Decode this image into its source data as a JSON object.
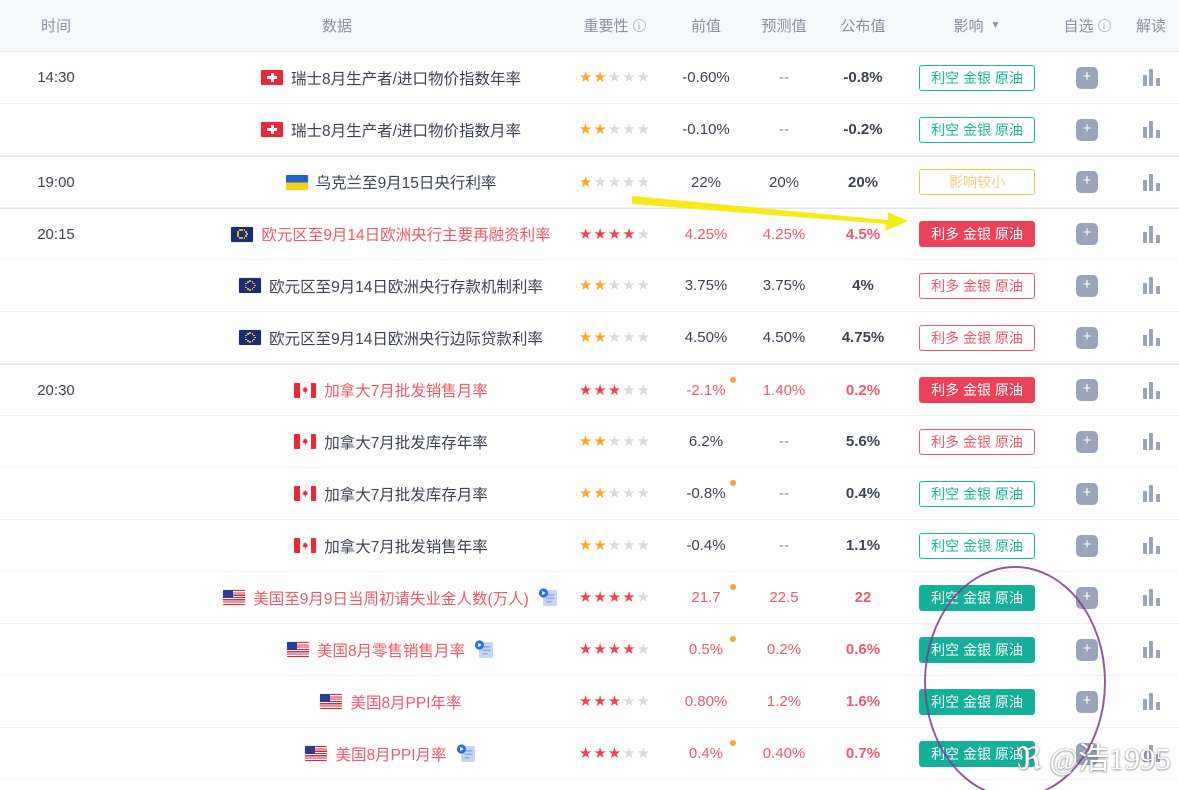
{
  "header": {
    "columns": [
      {
        "key": "time",
        "label": "时间",
        "icon": null,
        "sort": false
      },
      {
        "key": "data",
        "label": "数据",
        "icon": null,
        "sort": false
      },
      {
        "key": "importance",
        "label": "重要性",
        "icon": "info-icon",
        "sort": false
      },
      {
        "key": "previous",
        "label": "前值",
        "icon": null,
        "sort": false
      },
      {
        "key": "forecast",
        "label": "预测值",
        "icon": null,
        "sort": false
      },
      {
        "key": "actual",
        "label": "公布值",
        "icon": null,
        "sort": false
      },
      {
        "key": "effect",
        "label": "影响",
        "icon": null,
        "sort": true
      },
      {
        "key": "favorite",
        "label": "自选",
        "icon": "info-icon",
        "sort": false
      },
      {
        "key": "read",
        "label": "解读",
        "icon": null,
        "sort": false
      }
    ],
    "sort_caret": "▼"
  },
  "colors": {
    "accent_red": "#f2576b",
    "solid_red": "#ec4259",
    "teal": "#16b8a0",
    "solid_teal": "#14b09a",
    "amber": "#f5c24b",
    "star_gold": "#f7a828",
    "star_red": "#ef4357",
    "header_bg": "#f7f8fa",
    "annotation_yellow": "#f6ea16",
    "annotation_purple": "#7b3f8f"
  },
  "rows": [
    {
      "time": "14:30",
      "group_start": false,
      "flag": "switzerland",
      "name": "瑞士8月生产者/进口物价指数年率",
      "highlight": false,
      "has_article_icon": false,
      "stars": 2,
      "star_color": "gold",
      "previous": "-0.60%",
      "previous_revised": false,
      "forecast": "--",
      "actual": "-0.8%",
      "actual_highlight": false,
      "effect": "利空 金银 原油",
      "effect_style": "outline-green",
      "favorite": "+",
      "read": "chart-icon"
    },
    {
      "time": "",
      "group_start": false,
      "flag": "switzerland",
      "name": "瑞士8月生产者/进口物价指数月率",
      "highlight": false,
      "has_article_icon": false,
      "stars": 2,
      "star_color": "gold",
      "previous": "-0.10%",
      "previous_revised": false,
      "forecast": "--",
      "actual": "-0.2%",
      "actual_highlight": false,
      "effect": "利空 金银 原油",
      "effect_style": "outline-green",
      "favorite": "+",
      "read": "chart-icon"
    },
    {
      "time": "19:00",
      "group_start": true,
      "flag": "ukraine",
      "name": "乌克兰至9月15日央行利率",
      "highlight": false,
      "has_article_icon": false,
      "stars": 1,
      "star_color": "gold",
      "previous": "22%",
      "previous_revised": false,
      "forecast": "20%",
      "actual": "20%",
      "actual_highlight": false,
      "effect": "影响较小",
      "effect_style": "outline-amber",
      "favorite": "+",
      "read": "chart-icon"
    },
    {
      "time": "20:15",
      "group_start": true,
      "flag": "eu",
      "name": "欧元区至9月14日欧洲央行主要再融资利率",
      "highlight": true,
      "has_article_icon": false,
      "stars": 4,
      "star_color": "red",
      "previous": "4.25%",
      "previous_revised": false,
      "forecast": "4.25%",
      "actual": "4.5%",
      "actual_highlight": true,
      "effect": "利多 金银 原油",
      "effect_style": "solid-red",
      "favorite": "+",
      "read": "chart-icon"
    },
    {
      "time": "",
      "group_start": false,
      "flag": "eu",
      "name": "欧元区至9月14日欧洲央行存款机制利率",
      "highlight": false,
      "has_article_icon": false,
      "stars": 2,
      "star_color": "gold",
      "previous": "3.75%",
      "previous_revised": false,
      "forecast": "3.75%",
      "actual": "4%",
      "actual_highlight": false,
      "effect": "利多 金银 原油",
      "effect_style": "outline-red",
      "favorite": "+",
      "read": "chart-icon"
    },
    {
      "time": "",
      "group_start": false,
      "flag": "eu",
      "name": "欧元区至9月14日欧洲央行边际贷款利率",
      "highlight": false,
      "has_article_icon": false,
      "stars": 2,
      "star_color": "gold",
      "previous": "4.50%",
      "previous_revised": false,
      "forecast": "4.50%",
      "actual": "4.75%",
      "actual_highlight": false,
      "effect": "利多 金银 原油",
      "effect_style": "outline-red",
      "favorite": "+",
      "read": "chart-icon"
    },
    {
      "time": "20:30",
      "group_start": true,
      "flag": "canada",
      "name": "加拿大7月批发销售月率",
      "highlight": true,
      "has_article_icon": false,
      "stars": 3,
      "star_color": "red",
      "previous": "-2.1%",
      "previous_revised": true,
      "forecast": "1.40%",
      "actual": "0.2%",
      "actual_highlight": true,
      "effect": "利多 金银 原油",
      "effect_style": "solid-red",
      "favorite": "+",
      "read": "chart-icon"
    },
    {
      "time": "",
      "group_start": false,
      "flag": "canada",
      "name": "加拿大7月批发库存年率",
      "highlight": false,
      "has_article_icon": false,
      "stars": 2,
      "star_color": "gold",
      "previous": "6.2%",
      "previous_revised": false,
      "forecast": "--",
      "actual": "5.6%",
      "actual_highlight": false,
      "effect": "利多 金银 原油",
      "effect_style": "outline-red",
      "favorite": "+",
      "read": "chart-icon"
    },
    {
      "time": "",
      "group_start": false,
      "flag": "canada",
      "name": "加拿大7月批发库存月率",
      "highlight": false,
      "has_article_icon": false,
      "stars": 2,
      "star_color": "gold",
      "previous": "-0.8%",
      "previous_revised": true,
      "forecast": "--",
      "actual": "0.4%",
      "actual_highlight": false,
      "effect": "利空 金银 原油",
      "effect_style": "outline-green",
      "favorite": "+",
      "read": "chart-icon"
    },
    {
      "time": "",
      "group_start": false,
      "flag": "canada",
      "name": "加拿大7月批发销售年率",
      "highlight": false,
      "has_article_icon": false,
      "stars": 2,
      "star_color": "gold",
      "previous": "-0.4%",
      "previous_revised": false,
      "forecast": "--",
      "actual": "1.1%",
      "actual_highlight": false,
      "effect": "利空 金银 原油",
      "effect_style": "outline-green",
      "favorite": "+",
      "read": "chart-icon"
    },
    {
      "time": "",
      "group_start": false,
      "flag": "usa",
      "name": "美国至9月9日当周初请失业金人数(万人)",
      "highlight": true,
      "has_article_icon": true,
      "stars": 4,
      "star_color": "red",
      "previous": "21.7",
      "previous_revised": true,
      "forecast": "22.5",
      "actual": "22",
      "actual_highlight": true,
      "effect": "利空 金银 原油",
      "effect_style": "solid-green",
      "favorite": "+",
      "read": "chart-icon"
    },
    {
      "time": "",
      "group_start": false,
      "flag": "usa",
      "name": "美国8月零售销售月率",
      "highlight": true,
      "has_article_icon": true,
      "stars": 4,
      "star_color": "red",
      "previous": "0.5%",
      "previous_revised": true,
      "forecast": "0.2%",
      "actual": "0.6%",
      "actual_highlight": true,
      "effect": "利空 金银 原油",
      "effect_style": "solid-green",
      "favorite": "+",
      "read": "chart-icon"
    },
    {
      "time": "",
      "group_start": false,
      "flag": "usa",
      "name": "美国8月PPI年率",
      "highlight": true,
      "has_article_icon": false,
      "stars": 3,
      "star_color": "red",
      "previous": "0.80%",
      "previous_revised": false,
      "forecast": "1.2%",
      "actual": "1.6%",
      "actual_highlight": true,
      "effect": "利空 金银 原油",
      "effect_style": "solid-green",
      "favorite": "+",
      "read": "chart-icon"
    },
    {
      "time": "",
      "group_start": false,
      "flag": "usa",
      "name": "美国8月PPI月率",
      "highlight": true,
      "has_article_icon": true,
      "stars": 3,
      "star_color": "red",
      "previous": "0.4%",
      "previous_revised": true,
      "forecast": "0.40%",
      "actual": "0.7%",
      "actual_highlight": true,
      "effect": "利空 金银 原油",
      "effect_style": "solid-green",
      "favorite": "+",
      "read": "chart-icon"
    }
  ],
  "annotations": {
    "arrow": {
      "type": "arrow",
      "direction": "right",
      "color": "#f6ea16"
    },
    "ellipse": {
      "type": "ellipse",
      "color": "#7b3f8f"
    }
  },
  "watermark": {
    "user": "ℜ @浩1995"
  }
}
